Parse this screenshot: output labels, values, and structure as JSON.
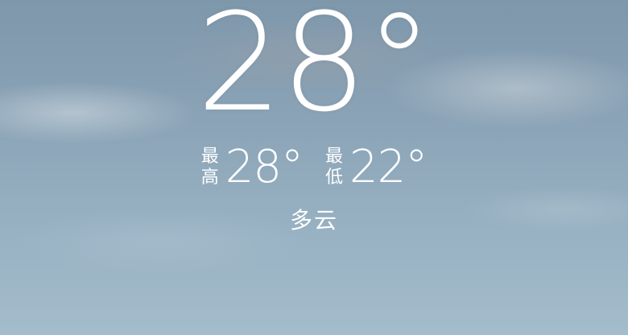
{
  "weather": {
    "current_temperature": "28°",
    "high": {
      "label_line1": "最",
      "label_line2": "高",
      "value": "28°"
    },
    "low": {
      "label_line1": "最",
      "label_line2": "低",
      "value": "22°"
    },
    "condition": "多云"
  },
  "colors": {
    "text": "#ffffff",
    "sky_top": "#7e97ab",
    "sky_bottom": "#a4bccb"
  }
}
